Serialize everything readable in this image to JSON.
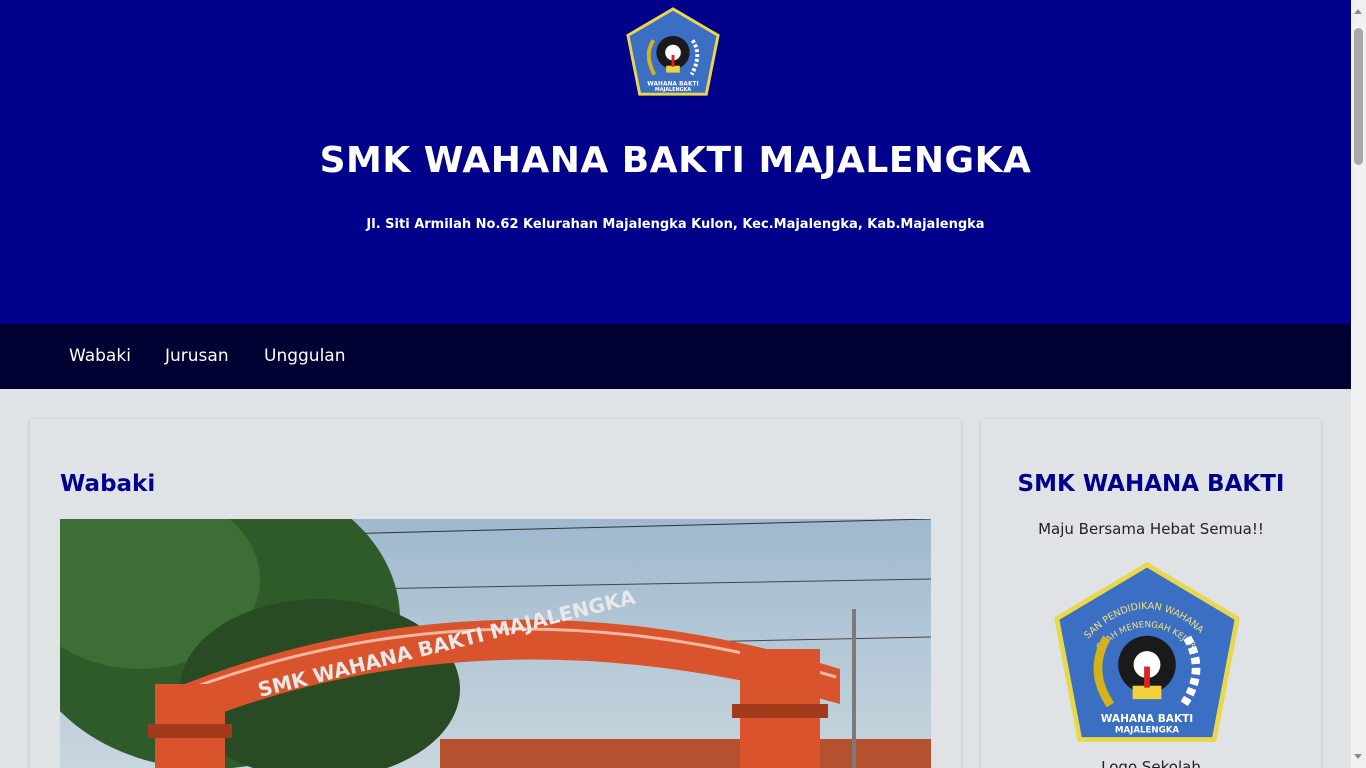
{
  "header": {
    "title": "SMK WAHANA BAKTI MAJALENGKA",
    "address": "Jl. Siti Armilah No.62 Kelurahan Majalengka Kulon, Kec.Majalengka, Kab.Majalengka",
    "logo_icon": "school-crest-icon",
    "background_color": "#00008b"
  },
  "nav": {
    "items": [
      {
        "label": "Wabaki"
      },
      {
        "label": "Jurusan"
      },
      {
        "label": "Unggulan"
      }
    ],
    "background_color": "#000033"
  },
  "main": {
    "section_title": "Wabaki",
    "photo_sign_text": "SMK WAHANA BAKTI MAJALENGKA"
  },
  "sidebar": {
    "title": "SMK WAHANA BAKTI",
    "tagline": "Maju Bersama Hebat Semua!!",
    "logo_caption": "Logo Sekolah",
    "logo_text_top": "YAYASAN PENDIDIKAN WAHANA BAKTI",
    "logo_text_mid": "SEKOLAH MENENGAH KEJURUAN",
    "logo_text_bottom_1": "WAHANA BAKTI",
    "logo_text_bottom_2": "MAJALENGKA"
  },
  "colors": {
    "accent": "#00008b",
    "page_bg": "#dfe3e6"
  }
}
